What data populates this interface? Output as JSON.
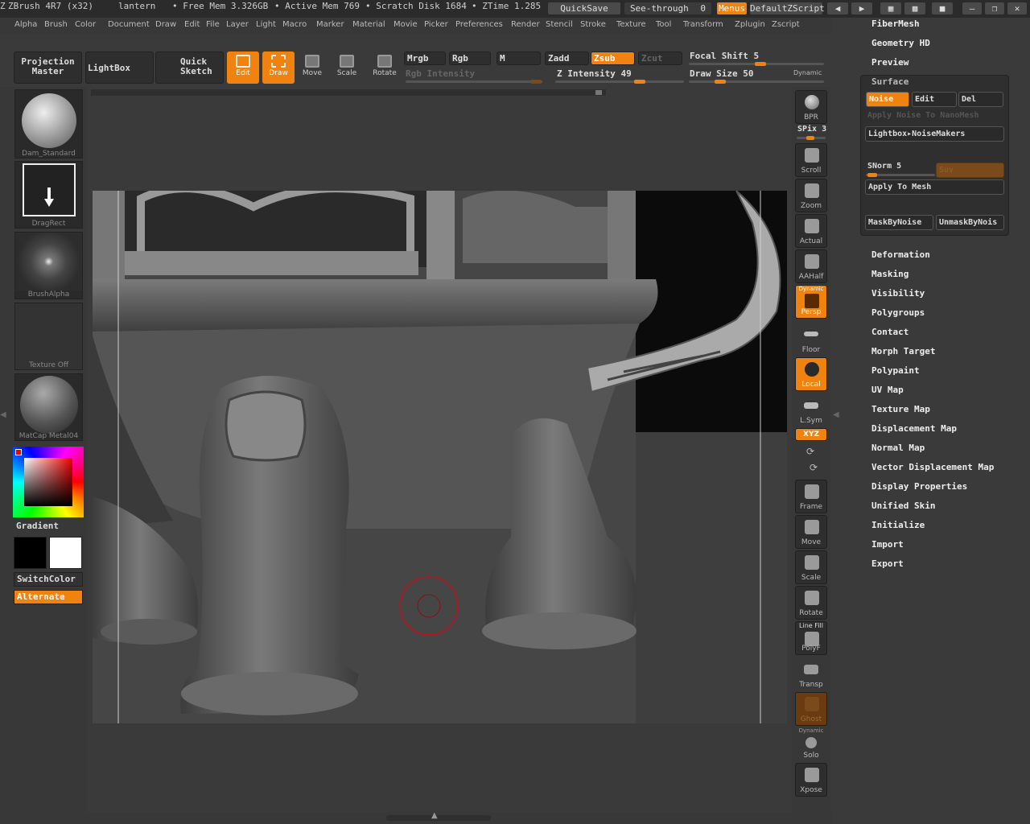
{
  "title_bar": {
    "app": "ZBrush 4R7 (x32)",
    "document": "lantern",
    "free_mem": "• Free Mem 3.326GB",
    "active_mem": "• Active Mem 769",
    "scratch_disk": "• Scratch Disk 1684",
    "ztime": "• ZTime 1.285",
    "quicksave": "QuickSave",
    "see_through_label": "See-through",
    "see_through_value": "0",
    "menus": "Menus",
    "default_zscript": "DefaultZScript"
  },
  "menu_bar": [
    "Alpha",
    "Brush",
    "Color",
    "Document",
    "Draw",
    "Edit",
    "File",
    "Layer",
    "Light",
    "Macro",
    "Marker",
    "Material",
    "Movie",
    "Picker",
    "Preferences",
    "Render",
    "Stencil",
    "Stroke",
    "Texture",
    "Tool",
    "Transform",
    "Zplugin",
    "Zscript"
  ],
  "toolbar": {
    "projection_master": "Projection Master",
    "lightbox": "LightBox",
    "quick_sketch": "Quick Sketch",
    "edit": "Edit",
    "draw": "Draw",
    "move": "Move",
    "scale": "Scale",
    "rotate": "Rotate",
    "mrgb": "Mrgb",
    "rgb": "Rgb",
    "m": "M",
    "rgb_intensity": "Rgb Intensity",
    "zadd": "Zadd",
    "zsub": "Zsub",
    "zcut": "Zcut",
    "z_intensity": "Z Intensity 49",
    "z_intensity_value": 49,
    "focal_shift": "Focal Shift 5",
    "focal_shift_value": 5,
    "draw_size": "Draw Size 50",
    "draw_size_value": 50,
    "dynamic": "Dynamic"
  },
  "left_panel": {
    "brush": "Dam_Standard",
    "stroke": "DragRect",
    "alpha": "BrushAlpha",
    "texture": "Texture Off",
    "material": "MatCap Metal04",
    "gradient": "Gradient",
    "switch_color": "SwitchColor",
    "alternate": "Alternate"
  },
  "right_shelf": {
    "bpr": "BPR",
    "spix": "SPix 3",
    "scroll": "Scroll",
    "zoom": "Zoom",
    "actual": "Actual",
    "aahalf": "AAHalf",
    "persp_dynamic": "Dynamic",
    "persp": "Persp",
    "floor": "Floor",
    "local": "Local",
    "lsym": "L.Sym",
    "xyz": "XYZ",
    "frame": "Frame",
    "move": "Move",
    "scale": "Scale",
    "rotate": "Rotate",
    "line_fill": "Line Fill",
    "polyf": "PolyF",
    "transp": "Transp",
    "ghost": "Ghost",
    "solo_dynamic": "Dynamic",
    "solo": "Solo",
    "xpose": "Xpose"
  },
  "right_menu": {
    "fibermesh": "FiberMesh",
    "geometry_hd": "Geometry HD",
    "preview": "Preview",
    "surface": "Surface",
    "noise": "Noise",
    "edit": "Edit",
    "del": "Del",
    "apply_noise_nano": "Apply Noise To NanoMesh",
    "lightbox_noisemakers": "Lightbox▸NoiseMakers",
    "snorm": "SNorm 5",
    "snorm_value": 5,
    "suv": "Suv",
    "apply_to_mesh": "Apply To Mesh",
    "mask_by_noise": "MaskByNoise",
    "unmask_by_noise": "UnmaskByNois",
    "items": [
      "Deformation",
      "Masking",
      "Visibility",
      "Polygroups",
      "Contact",
      "Morph Target",
      "Polypaint",
      "UV Map",
      "Texture Map",
      "Displacement Map",
      "Normal Map",
      "Vector Displacement Map",
      "Display Properties",
      "Unified Skin",
      "Initialize",
      "Import",
      "Export"
    ]
  },
  "colors": {
    "accent": "#f0820f",
    "panel": "#383838",
    "canvas": "#3f3f3f"
  }
}
